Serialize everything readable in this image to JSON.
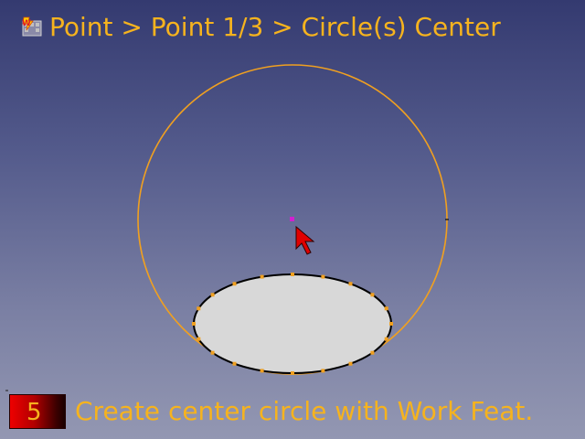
{
  "header": {
    "breadcrumb": "Point > Point 1/3 > Circle(s) Center",
    "workbench_icon": "part-workbench-icon"
  },
  "footer": {
    "step_number": "5",
    "caption": "Create center circle with Work Feat."
  },
  "colors": {
    "text": "#f6b31e",
    "construction_circle": "#f0a020",
    "ellipse_fill": "#d8d8d8",
    "ellipse_outline": "#000000",
    "center_point": "#d020d0",
    "cursor": "#e00000",
    "step_badge": "#cc0000"
  },
  "viewport": {
    "cursor_icon": "arrow-cursor-icon"
  }
}
